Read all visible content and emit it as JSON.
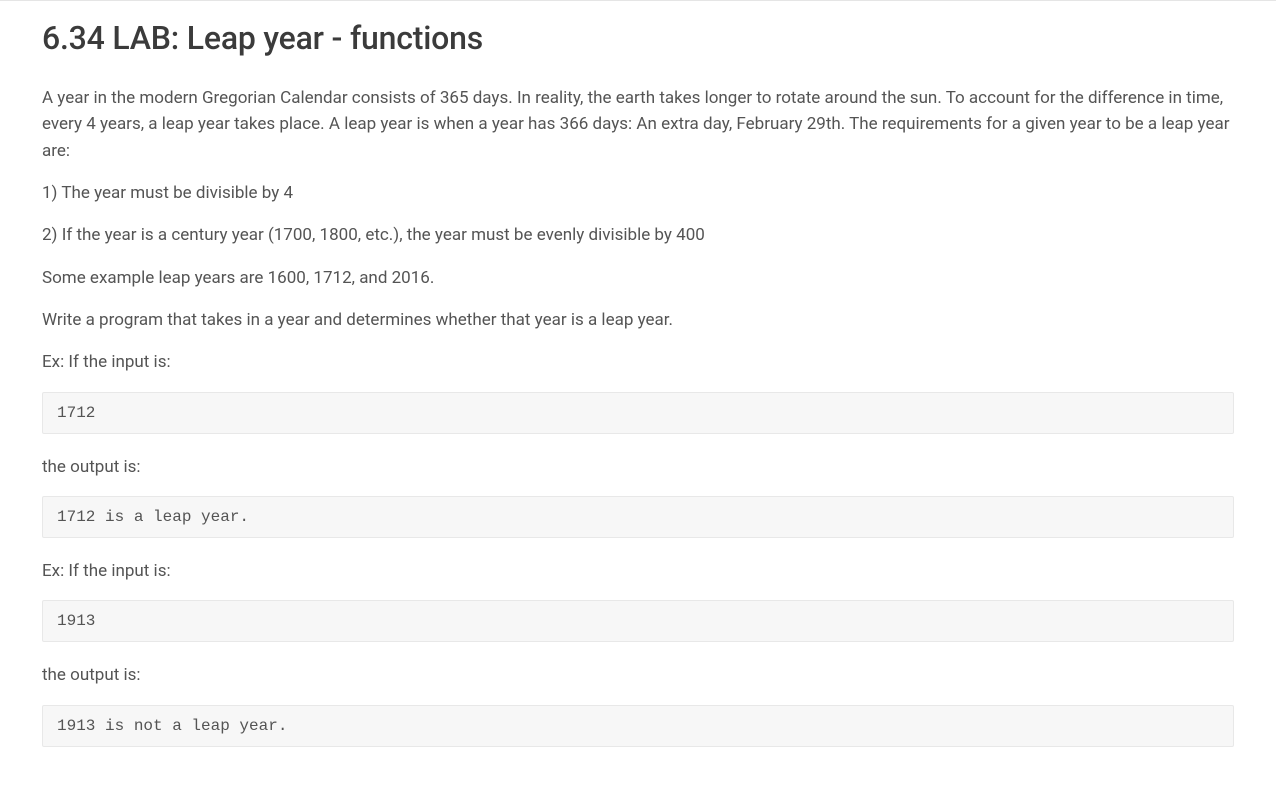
{
  "title": "6.34 LAB: Leap year - functions",
  "paragraphs": {
    "intro": "A year in the modern Gregorian Calendar consists of 365 days. In reality, the earth takes longer to rotate around the sun. To account for the difference in time, every 4 years, a leap year takes place. A leap year is when a year has 366 days: An extra day, February 29th. The requirements for a given year to be a leap year are:",
    "rule1": "1) The year must be divisible by 4",
    "rule2": "2) If the year is a century year (1700, 1800, etc.), the year must be evenly divisible by 400",
    "examples_line": "Some example leap years are 1600, 1712, and 2016.",
    "task": "Write a program that takes in a year and determines whether that year is a leap year.",
    "ex1_prompt": "Ex: If the input is:",
    "ex1_input": "1712",
    "ex1_output_label": "the output is:",
    "ex1_output": "1712 is a leap year.",
    "ex2_prompt": "Ex: If the input is:",
    "ex2_input": "1913",
    "ex2_output_label": "the output is:",
    "ex2_output": "1913 is not a leap year."
  }
}
